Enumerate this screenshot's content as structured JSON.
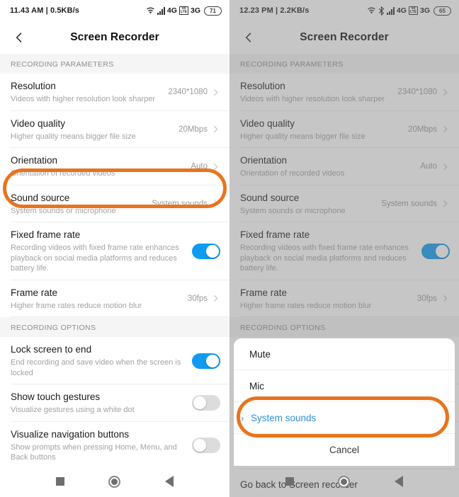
{
  "screens": [
    {
      "id": "left",
      "statusbar": {
        "time_and_speed": "11.43 AM | 0.5KB/s",
        "has_bluetooth": false,
        "net_primary": "4G",
        "net_secondary": "3G",
        "volte_label": "VoLTE",
        "battery": "71"
      },
      "appbar": {
        "title": "Screen Recorder",
        "back_icon": "chevron-left-icon"
      },
      "sections": [
        {
          "header": "RECORDING PARAMETERS",
          "rows": [
            {
              "title": "Resolution",
              "subtitle": "Videos with higher resolution look sharper",
              "value": "2340*1080",
              "type": "chevron"
            },
            {
              "title": "Video quality",
              "subtitle": "Higher quality means bigger file size",
              "value": "20Mbps",
              "type": "chevron"
            },
            {
              "title": "Orientation",
              "subtitle": "Orientation of recorded videos",
              "value": "Auto",
              "type": "chevron"
            },
            {
              "title": "Sound source",
              "subtitle": "System sounds or microphone",
              "value": "System sounds",
              "type": "chevron",
              "highlighted": true
            },
            {
              "title": "Fixed frame rate",
              "subtitle": "Recording videos with fixed frame rate enhances playback on social media platforms and reduces battery life.",
              "value": "",
              "type": "toggle",
              "toggle_on": true
            },
            {
              "title": "Frame rate",
              "subtitle": "Higher frame rates reduce motion blur",
              "value": "30fps",
              "type": "chevron"
            }
          ]
        },
        {
          "header": "RECORDING OPTIONS",
          "rows": [
            {
              "title": "Lock screen to end",
              "subtitle": "End recording and save video when the screen is locked",
              "value": "",
              "type": "toggle",
              "toggle_on": true
            },
            {
              "title": "Show touch gestures",
              "subtitle": "Visualize gestures using a white dot",
              "value": "",
              "type": "toggle",
              "toggle_on": false
            },
            {
              "title": "Visualize navigation buttons",
              "subtitle": "Show prompts when pressing Home, Menu, and Back buttons",
              "value": "",
              "type": "toggle",
              "toggle_on": false
            },
            {
              "title": "Go back to Screen recorder",
              "subtitle": "",
              "value": "",
              "type": "plain"
            }
          ]
        }
      ],
      "navbar": {
        "recents": "recents-square-icon",
        "home": "home-circle-icon",
        "back": "back-triangle-icon"
      },
      "dialog": null
    },
    {
      "id": "right",
      "statusbar": {
        "time_and_speed": "12.23 PM | 2.2KB/s",
        "has_bluetooth": true,
        "net_primary": "4G",
        "net_secondary": "3G",
        "volte_label": "VoLTE",
        "battery": "65"
      },
      "appbar": {
        "title": "Screen Recorder",
        "back_icon": "chevron-left-icon"
      },
      "sections": [
        {
          "header": "RECORDING PARAMETERS",
          "rows": [
            {
              "title": "Resolution",
              "subtitle": "Videos with higher resolution look sharper",
              "value": "2340*1080",
              "type": "chevron"
            },
            {
              "title": "Video quality",
              "subtitle": "Higher quality means bigger file size",
              "value": "20Mbps",
              "type": "chevron"
            },
            {
              "title": "Orientation",
              "subtitle": "Orientation of recorded videos",
              "value": "Auto",
              "type": "chevron"
            },
            {
              "title": "Sound source",
              "subtitle": "System sounds or microphone",
              "value": "System sounds",
              "type": "chevron"
            },
            {
              "title": "Fixed frame rate",
              "subtitle": "Recording videos with fixed frame rate enhances playback on social media platforms and reduces battery life.",
              "value": "",
              "type": "toggle",
              "toggle_on": true
            },
            {
              "title": "Frame rate",
              "subtitle": "Higher frame rates reduce motion blur",
              "value": "30fps",
              "type": "chevron"
            }
          ]
        },
        {
          "header": "RECORDING OPTIONS",
          "rows": [
            {
              "title": "Lock screen to end",
              "subtitle": "End recording and save video when the screen is locked",
              "value": "",
              "type": "toggle",
              "toggle_on": true
            },
            {
              "title": "Show touch gestures",
              "subtitle": "Visualize gestures using a white dot",
              "value": "",
              "type": "toggle",
              "toggle_on": false
            },
            {
              "title": "Visualize navigation buttons",
              "subtitle": "Show prompts when pressing Home, Menu, and Back buttons",
              "value": "",
              "type": "toggle",
              "toggle_on": false
            },
            {
              "title": "Go back to Screen recorder",
              "subtitle": "",
              "value": "",
              "type": "plain"
            }
          ]
        }
      ],
      "navbar": {
        "recents": "recents-square-icon",
        "home": "home-circle-icon",
        "back": "back-triangle-icon"
      },
      "dialog": {
        "options": [
          {
            "label": "Mute",
            "selected": false
          },
          {
            "label": "Mic",
            "selected": false
          },
          {
            "label": "System sounds",
            "selected": true
          }
        ],
        "cancel_label": "Cancel",
        "selected_marker": "›",
        "highlighted_option_index": 2
      }
    }
  ],
  "colors": {
    "accent_highlight": "#e8741e",
    "toggle_on": "#0f9bf0",
    "selected_text": "#2f8fd6",
    "section_bg": "#f5f5f5"
  }
}
